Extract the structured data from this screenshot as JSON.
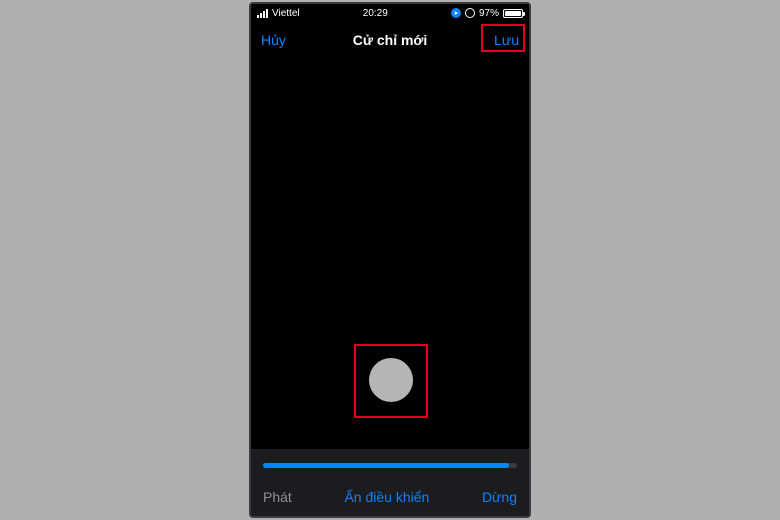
{
  "status": {
    "carrier": "Viettel",
    "time": "20:29",
    "battery_pct": "97%"
  },
  "nav": {
    "cancel": "Hủy",
    "title": "Cử chỉ mới",
    "save": "Lưu"
  },
  "gesture": {
    "dot_icon": "touch-dot"
  },
  "toolbar": {
    "play": "Phát",
    "hide_controls": "Ẩn điều khiển",
    "stop": "Dừng"
  },
  "accent_color": "#0a84ff",
  "highlight_color": "#e3001b"
}
